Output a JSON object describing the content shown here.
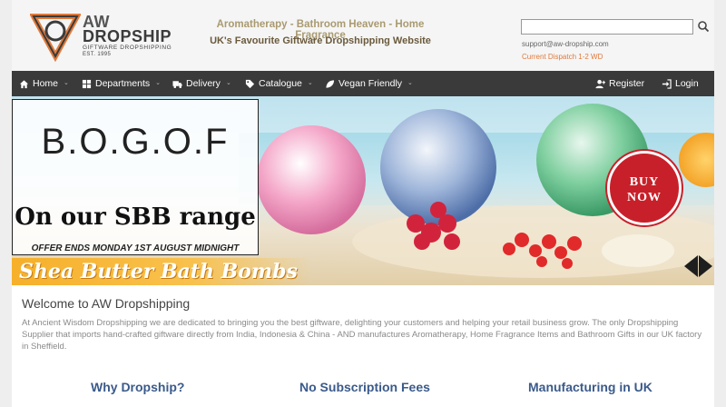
{
  "header": {
    "logo": {
      "line1": "AW",
      "line2": "DROPSHIP",
      "line3": "GIFTWARE DROPSHIPPING",
      "line4": "EST. 1995"
    },
    "tagline_top": "Aromatherapy - Bathroom Heaven - Home Fragrance",
    "tagline_bottom": "UK's Favourite Giftware Dropshipping Website",
    "search": {
      "placeholder": "",
      "value": ""
    },
    "support_email": "support@aw-dropship.com",
    "dispatch": "Current Dispatch 1-2 WD"
  },
  "nav": {
    "items": [
      {
        "label": "Home",
        "icon": "home-icon"
      },
      {
        "label": "Departments",
        "icon": "grid-icon"
      },
      {
        "label": "Delivery",
        "icon": "truck-icon"
      },
      {
        "label": "Catalogue",
        "icon": "tag-icon"
      },
      {
        "label": "Vegan Friendly",
        "icon": "leaf-icon"
      }
    ],
    "register": "Register",
    "login": "Login"
  },
  "banner": {
    "headline": "B.O.G.O.F",
    "subhead": "On our SBB range",
    "offer": "OFFER ENDS MONDAY 1ST AUGUST MIDNIGHT",
    "strip": "Shea Butter Bath Bombs",
    "cta_line1": "BUY",
    "cta_line2": "NOW"
  },
  "content": {
    "welcome_title": "Welcome to AW Dropshipping",
    "intro": "At Ancient Wisdom Dropshipping we are dedicated to bringing you the best giftware, delighting your customers and helping your retail business grow. The only  Dropshipping Supplier that imports hand-crafted giftware directly from India, Indonesia & China - AND manufactures Aromatherapy, Home Fragrance Items and Bathroom Gifts in our UK factory in Sheffield.",
    "features": [
      "Why Dropship?",
      "No Subscription Fees",
      "Manufacturing in UK"
    ]
  },
  "colors": {
    "nav_bg": "#3a3a3a",
    "accent_orange": "#e07a3c",
    "feature_blue": "#3a5a8a",
    "buy_red": "#c8202a"
  }
}
